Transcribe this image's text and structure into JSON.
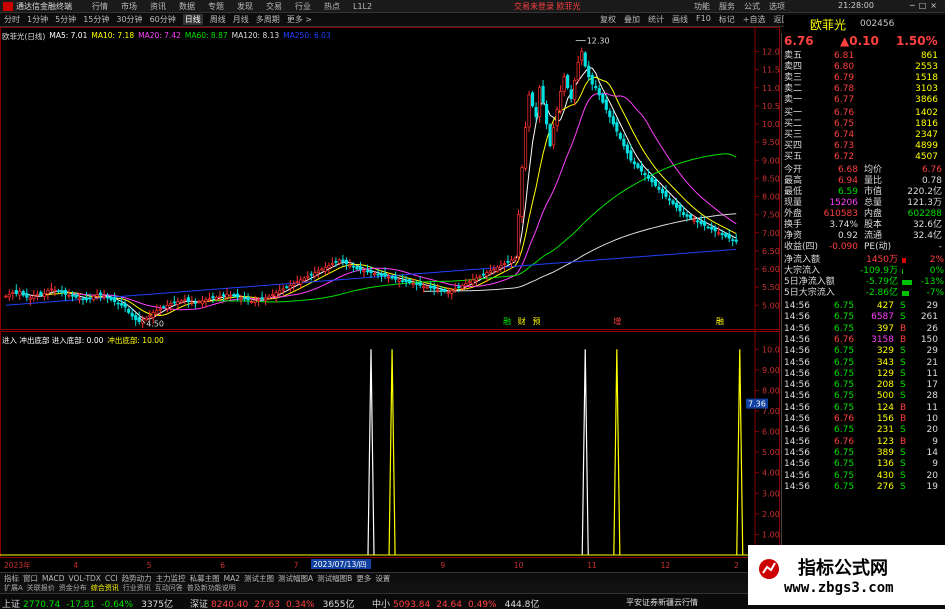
{
  "menubar": {
    "app_title": "通达信金融终端",
    "menus": [
      "行情",
      "市场",
      "资讯",
      "数据",
      "专题",
      "发现",
      "交易",
      "行业",
      "热点",
      "L1L2"
    ],
    "center_text": "交易未登录  欧菲光",
    "right_items": [
      "功能",
      "服务",
      "公式",
      "选项"
    ],
    "clock": "21:28:00"
  },
  "toolbar": {
    "periods": [
      "分时",
      "1分钟",
      "5分钟",
      "15分钟",
      "30分钟",
      "60分钟",
      "日线",
      "周线",
      "月线",
      "多周期",
      "更多 >"
    ],
    "active_period": "日线",
    "right_buttons": [
      "复权",
      "叠加",
      "统计",
      "画线",
      "F10",
      "标记",
      "+自选",
      "返回"
    ]
  },
  "stock": {
    "name": "欧菲光",
    "code": "002456",
    "price": "6.76",
    "change": "▲0.10",
    "change_pct": "1.50%"
  },
  "ma_legend": {
    "name": "欧菲光(日线)",
    "items": [
      {
        "label": "MA5: 7.01",
        "color": "#ffffff"
      },
      {
        "label": "MA10: 7.18",
        "color": "#ffff00"
      },
      {
        "label": "MA20: 7.42",
        "color": "#ff40ff"
      },
      {
        "label": "MA60: 8.87",
        "color": "#00e000"
      },
      {
        "label": "MA120: 8.13",
        "color": "#dddddd"
      },
      {
        "label": "MA250: 6.03",
        "color": "#2040ff"
      }
    ]
  },
  "sub_legend": {
    "items": [
      {
        "label": "进入 冲出底部 进入底部: 0.00",
        "color": "#ffffff"
      },
      {
        "label": "冲出底部: 10.00",
        "color": "#ffff00"
      }
    ]
  },
  "orderbook": {
    "asks": [
      {
        "label": "卖五",
        "price": "6.81",
        "vol": "861"
      },
      {
        "label": "卖四",
        "price": "6.80",
        "vol": "2553"
      },
      {
        "label": "卖三",
        "price": "6.79",
        "vol": "1518"
      },
      {
        "label": "卖二",
        "price": "6.78",
        "vol": "3103"
      },
      {
        "label": "卖一",
        "price": "6.77",
        "vol": "3866"
      }
    ],
    "bids": [
      {
        "label": "买一",
        "price": "6.76",
        "vol": "1402"
      },
      {
        "label": "买二",
        "price": "6.75",
        "vol": "1816"
      },
      {
        "label": "买三",
        "price": "6.74",
        "vol": "2347"
      },
      {
        "label": "买四",
        "price": "6.73",
        "vol": "4899"
      },
      {
        "label": "买五",
        "price": "6.72",
        "vol": "4507"
      }
    ]
  },
  "quote_stats": [
    {
      "l1": "今开",
      "v1": "6.68",
      "l2": "均价",
      "v2": "6.76"
    },
    {
      "l1": "最高",
      "v1": "6.94",
      "l2": "量比",
      "v2": "0.78"
    },
    {
      "l1": "最低",
      "v1": "6.59",
      "l2": "市值",
      "v2": "220.2亿"
    },
    {
      "l1": "现量",
      "v1": "15206",
      "l2": "总量",
      "v2": "121.3万"
    },
    {
      "l1": "外盘",
      "v1": "610583",
      "l2": "内盘",
      "v2": "602288"
    },
    {
      "l1": "换手",
      "v1": "3.74%",
      "l2": "股本",
      "v2": "32.6亿"
    },
    {
      "l1": "净资",
      "v1": "0.92",
      "l2": "流通",
      "v2": "32.4亿"
    },
    {
      "l1": "收益(四)",
      "v1": "-0.090",
      "l2": "PE(动)",
      "v2": "-"
    }
  ],
  "fund_flow": [
    {
      "label": "净流入额",
      "value": "1450万",
      "pct": "2%",
      "bar": 0.2
    },
    {
      "label": "大宗流入",
      "value": "-109.9万",
      "pct": "0%",
      "bar": 0.05
    },
    {
      "label": "5日净流入额",
      "value": "-5.79亿",
      "pct": "-13%",
      "bar": 0.5
    },
    {
      "label": "5日大宗流入",
      "value": "-2.86亿",
      "pct": "-7%",
      "bar": 0.35
    }
  ],
  "ticks": [
    {
      "time": "14:56",
      "price": "6.75",
      "vol": "427",
      "bs": "S",
      "n": "29"
    },
    {
      "time": "14:56",
      "price": "6.75",
      "vol": "6587",
      "bs": "S",
      "n": "261"
    },
    {
      "time": "14:56",
      "price": "6.75",
      "vol": "397",
      "bs": "B",
      "n": "26"
    },
    {
      "time": "14:56",
      "price": "6.76",
      "vol": "3158",
      "bs": "B",
      "n": "150"
    },
    {
      "time": "14:56",
      "price": "6.75",
      "vol": "329",
      "bs": "S",
      "n": "29"
    },
    {
      "time": "14:56",
      "price": "6.75",
      "vol": "343",
      "bs": "S",
      "n": "21"
    },
    {
      "time": "14:56",
      "price": "6.75",
      "vol": "129",
      "bs": "S",
      "n": "11"
    },
    {
      "time": "14:56",
      "price": "6.75",
      "vol": "208",
      "bs": "S",
      "n": "17"
    },
    {
      "time": "14:56",
      "price": "6.75",
      "vol": "500",
      "bs": "S",
      "n": "28"
    },
    {
      "time": "14:56",
      "price": "6.75",
      "vol": "124",
      "bs": "B",
      "n": "11"
    },
    {
      "time": "14:56",
      "price": "6.76",
      "vol": "156",
      "bs": "B",
      "n": "10"
    },
    {
      "time": "14:56",
      "price": "6.75",
      "vol": "231",
      "bs": "S",
      "n": "20"
    },
    {
      "time": "14:56",
      "price": "6.76",
      "vol": "123",
      "bs": "B",
      "n": "9"
    },
    {
      "time": "14:56",
      "price": "6.75",
      "vol": "389",
      "bs": "S",
      "n": "14"
    },
    {
      "time": "14:56",
      "price": "6.75",
      "vol": "136",
      "bs": "S",
      "n": "9"
    },
    {
      "time": "14:56",
      "price": "6.75",
      "vol": "430",
      "bs": "S",
      "n": "20"
    },
    {
      "time": "14:56",
      "price": "6.75",
      "vol": "276",
      "bs": "S",
      "n": "19"
    }
  ],
  "tabs": [
    "指标",
    "窗口",
    "MACD",
    "VOL-TDX",
    "CCI",
    "趋势动力",
    "主力监控",
    "私募主图",
    "MA2",
    "测试主图",
    "测试幅图A",
    "测试幅图B",
    "更多",
    "设置"
  ],
  "func_tabs": [
    "扩展A",
    "关联报价",
    "资金分布",
    "综合资讯",
    "行业资讯",
    "互动问答",
    "普及新功能说明"
  ],
  "status": [
    {
      "name": "上证",
      "value": "2770.74",
      "chg": "-17.81",
      "pct": "-0.64%",
      "amt": "3375亿",
      "dir": "dn"
    },
    {
      "name": "深证",
      "value": "8240.40",
      "chg": "27.63",
      "pct": "0.34%",
      "amt": "3655亿",
      "dir": "up"
    },
    {
      "name": "中小",
      "value": "5093.84",
      "chg": "24.64",
      "pct": "0.49%",
      "amt": "444.8亿",
      "dir": "up"
    }
  ],
  "status_right": "平安证券新疆云行情",
  "chart_data": [
    {
      "type": "candlestick",
      "title": "欧菲光(日线)",
      "y_ticks": [
        "12.00",
        "11.50",
        "11.00",
        "10.50",
        "10.00",
        "9.50",
        "9.00",
        "8.50",
        "8.00",
        "7.50",
        "7.00",
        "6.50",
        "6.00",
        "5.50",
        "5.00"
      ],
      "ylim": [
        4.4,
        12.4
      ],
      "high_annotation": "12.30",
      "low_annotation": "4.50",
      "close_tag": "7.36",
      "date_marker": "2023/07/13/四",
      "month_ticks": [
        "2023年",
        "4",
        "5",
        "6",
        "7",
        "8",
        "9",
        "10",
        "11",
        "12",
        "2"
      ],
      "event_labels": [
        "融",
        "财",
        "预",
        "增",
        "融"
      ],
      "close_prices": [
        5.25,
        5.3,
        5.35,
        5.32,
        5.38,
        5.28,
        5.22,
        5.2,
        5.25,
        5.3,
        5.28,
        5.32,
        5.4,
        5.45,
        5.42,
        5.38,
        5.35,
        5.3,
        5.28,
        5.25,
        5.22,
        5.2,
        5.18,
        5.15,
        5.2,
        5.25,
        5.3,
        5.28,
        5.25,
        5.2,
        5.15,
        5.1,
        5.05,
        5.0,
        4.95,
        4.8,
        4.7,
        4.6,
        4.55,
        4.6,
        4.65,
        4.72,
        4.8,
        4.85,
        4.9,
        4.95,
        5.0,
        5.05,
        5.08,
        5.1,
        5.12,
        5.15,
        5.1,
        5.08,
        5.05,
        5.1,
        5.12,
        5.15,
        5.18,
        5.2,
        5.22,
        5.25,
        5.28,
        5.3,
        5.28,
        5.25,
        5.22,
        5.2,
        5.18,
        5.15,
        5.1,
        5.12,
        5.15,
        5.18,
        5.2,
        5.25,
        5.3,
        5.35,
        5.4,
        5.45,
        5.5,
        5.55,
        5.6,
        5.65,
        5.7,
        5.75,
        5.8,
        5.85,
        5.9,
        5.95,
        6.0,
        6.05,
        6.1,
        6.15,
        6.2,
        6.25,
        6.2,
        6.15,
        6.1,
        6.05,
        6.0,
        5.98,
        5.95,
        5.92,
        5.9,
        5.88,
        5.85,
        5.82,
        5.8,
        5.78,
        5.75,
        5.72,
        5.7,
        5.68,
        5.65,
        5.62,
        5.6,
        5.58,
        5.55,
        5.52,
        5.5,
        5.48,
        5.45,
        5.42,
        5.4,
        5.38,
        5.35,
        5.4,
        5.45,
        5.5,
        5.55,
        5.6,
        5.65,
        5.7,
        5.75,
        5.8,
        5.85,
        5.9,
        5.95,
        6.0,
        6.05,
        6.1,
        6.15,
        6.2,
        6.25,
        6.3,
        7.5,
        8.8,
        9.9,
        10.8,
        10.5,
        10.2,
        11.0,
        10.6,
        10.0,
        9.4,
        9.9,
        10.4,
        10.9,
        11.3,
        11.0,
        10.7,
        11.2,
        11.7,
        12.0,
        11.6,
        11.3,
        11.1,
        11.0,
        10.8,
        10.6,
        10.4,
        10.2,
        10.0,
        9.8,
        9.6,
        9.4,
        9.2,
        9.0,
        8.9,
        8.8,
        8.7,
        8.6,
        8.5,
        8.4,
        8.3,
        8.2,
        8.1,
        8.0,
        7.9,
        7.8,
        7.7,
        7.6,
        7.5,
        7.45,
        7.4,
        7.35,
        7.3,
        7.25,
        7.2,
        7.15,
        7.1,
        7.05,
        7.0,
        6.95,
        6.9,
        6.85,
        6.8,
        6.76
      ]
    },
    {
      "type": "indicator",
      "title": "进入 冲出底部",
      "y_ticks": [
        "10.00",
        "9.00",
        "8.00",
        "7.00",
        "6.00",
        "5.00",
        "4.00",
        "3.00",
        "2.00",
        "1.00"
      ],
      "ylim": [
        0,
        10.5
      ],
      "spikes": [
        {
          "index": 104,
          "color": "#ffffff"
        },
        {
          "index": 110,
          "color": "#ffff00"
        },
        {
          "index": 165,
          "color": "#ffffff"
        },
        {
          "index": 174,
          "color": "#ffff00"
        },
        {
          "index": 209,
          "color": "#ffff00"
        }
      ],
      "spike_value": 10
    }
  ],
  "watermark": {
    "line1": "指标公式网",
    "line2": "www.zbgs3.com"
  }
}
